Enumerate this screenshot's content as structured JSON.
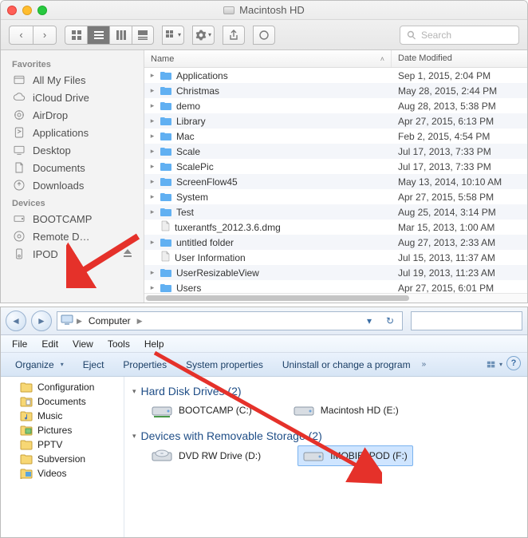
{
  "finder": {
    "window_title": "Macintosh HD",
    "search_placeholder": "Search",
    "sidebar": {
      "favorites_label": "Favorites",
      "devices_label": "Devices",
      "favorites": [
        {
          "label": "All My Files"
        },
        {
          "label": "iCloud Drive"
        },
        {
          "label": "AirDrop"
        },
        {
          "label": "Applications"
        },
        {
          "label": "Desktop"
        },
        {
          "label": "Documents"
        },
        {
          "label": "Downloads"
        }
      ],
      "devices": [
        {
          "label": "BOOTCAMP"
        },
        {
          "label": "Remote D…"
        },
        {
          "label": "IPOD"
        }
      ]
    },
    "columns": {
      "name": "Name",
      "date": "Date Modified"
    },
    "rows": [
      {
        "name": "Applications",
        "date": "Sep 1, 2015, 2:04 PM",
        "kind": "folder"
      },
      {
        "name": "Christmas",
        "date": "May 28, 2015, 2:44 PM",
        "kind": "folder"
      },
      {
        "name": "demo",
        "date": "Aug 28, 2013, 5:38 PM",
        "kind": "folder"
      },
      {
        "name": "Library",
        "date": "Apr 27, 2015, 6:13 PM",
        "kind": "folder"
      },
      {
        "name": "Mac",
        "date": "Feb 2, 2015, 4:54 PM",
        "kind": "folder"
      },
      {
        "name": "Scale",
        "date": "Jul 17, 2013, 7:33 PM",
        "kind": "folder"
      },
      {
        "name": "ScalePic",
        "date": "Jul 17, 2013, 7:33 PM",
        "kind": "folder"
      },
      {
        "name": "ScreenFlow45",
        "date": "May 13, 2014, 10:10 AM",
        "kind": "folder"
      },
      {
        "name": "System",
        "date": "Apr 27, 2015, 5:58 PM",
        "kind": "folder"
      },
      {
        "name": "Test",
        "date": "Aug 25, 2014, 3:14 PM",
        "kind": "folder"
      },
      {
        "name": "tuxerantfs_2012.3.6.dmg",
        "date": "Mar 15, 2013, 1:00 AM",
        "kind": "file"
      },
      {
        "name": "untitled folder",
        "date": "Aug 27, 2013, 2:33 AM",
        "kind": "folder"
      },
      {
        "name": "User Information",
        "date": "Jul 15, 2013, 11:37 AM",
        "kind": "file"
      },
      {
        "name": "UserResizableView",
        "date": "Jul 19, 2013, 11:23 AM",
        "kind": "folder"
      },
      {
        "name": "Users",
        "date": "Apr 27, 2015, 6:01 PM",
        "kind": "folder"
      }
    ]
  },
  "explorer": {
    "breadcrumb": "Computer",
    "menu": [
      "File",
      "Edit",
      "View",
      "Tools",
      "Help"
    ],
    "commands": {
      "organize": "Organize",
      "eject": "Eject",
      "properties": "Properties",
      "system_properties": "System properties",
      "uninstall": "Uninstall or change a program"
    },
    "tree": [
      {
        "label": "Configuration",
        "icon": "folder-blond"
      },
      {
        "label": "Documents",
        "icon": "folder-doc"
      },
      {
        "label": "Music",
        "icon": "folder-music"
      },
      {
        "label": "Pictures",
        "icon": "folder-pic"
      },
      {
        "label": "PPTV",
        "icon": "folder"
      },
      {
        "label": "Subversion",
        "icon": "folder"
      },
      {
        "label": "Videos",
        "icon": "folder-vid"
      }
    ],
    "groups": {
      "hdd_label": "Hard Disk Drives (2)",
      "removable_label": "Devices with Removable Storage (2)",
      "hdd": [
        {
          "label": "BOOTCAMP (C:)"
        },
        {
          "label": "Macintosh HD (E:)"
        }
      ],
      "removable": [
        {
          "label": "DVD RW Drive (D:)"
        },
        {
          "label": "IMOBIE IPOD (F:)",
          "selected": true
        }
      ]
    }
  }
}
